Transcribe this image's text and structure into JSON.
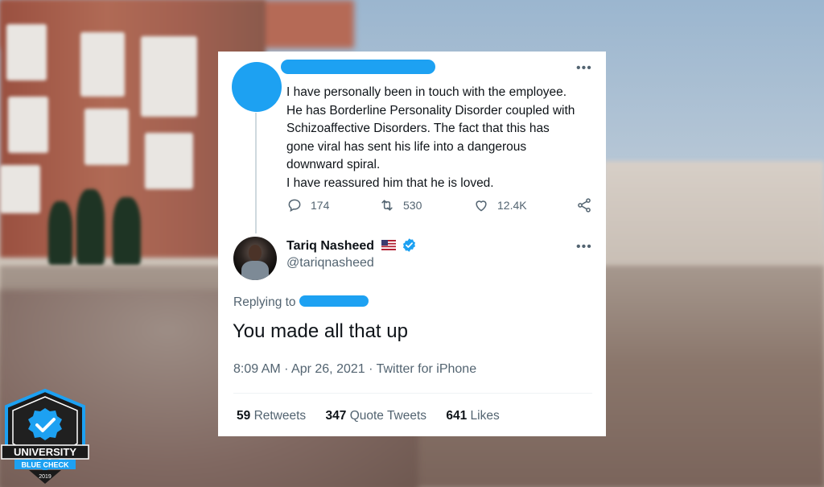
{
  "parent_tweet": {
    "lines": [
      "I have personally been in touch with the employee.",
      "He has Borderline Personality Disorder coupled with",
      "Schizoaffective Disorders. The fact that this has",
      "gone viral has sent his life into a dangerous",
      "downward spiral.",
      "I have reassured him that he is loved."
    ],
    "replies": "174",
    "retweets": "530",
    "likes": "12.4K",
    "more_label": "•••"
  },
  "reply_tweet": {
    "display_name": "Tariq Nasheed",
    "handle": "@tariqnasheed",
    "replying_to_label": "Replying to",
    "text": "You made all that up",
    "timestamp": "8:09 AM · Apr 26, 2021 · Twitter for iPhone",
    "more_label": "•••"
  },
  "stats": {
    "retweets_count": "59",
    "retweets_label": "Retweets",
    "quote_count": "347",
    "quote_label": "Quote Tweets",
    "likes_count": "641",
    "likes_label": "Likes"
  },
  "badge": {
    "line1": "UNIVERSITY",
    "line2": "BLUE CHECK",
    "year": "2019"
  },
  "colors": {
    "twitter_blue": "#1da1f2",
    "text_primary": "#0f1419",
    "text_secondary": "#536471"
  }
}
